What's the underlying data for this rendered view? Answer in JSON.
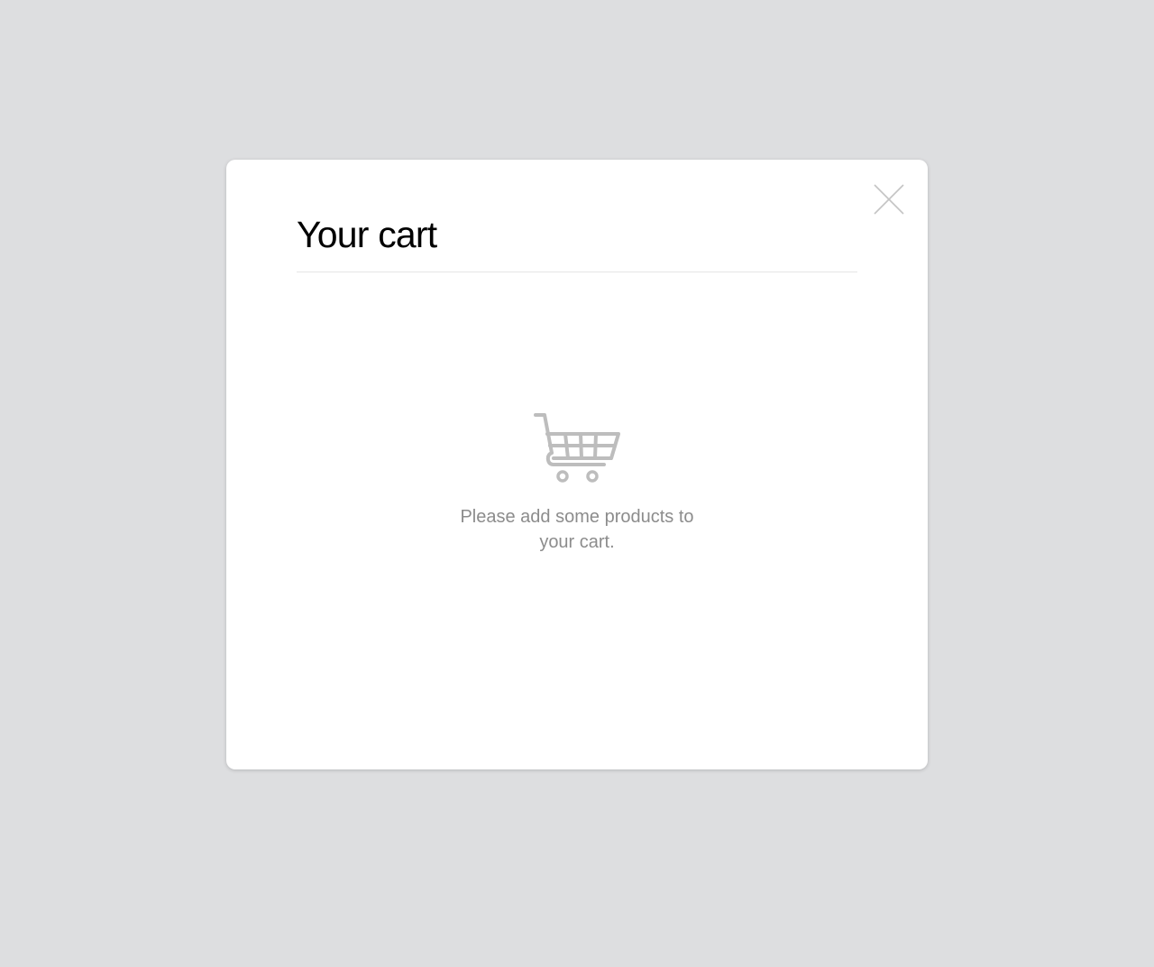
{
  "modal": {
    "title": "Your cart",
    "close_icon": "close-icon",
    "empty_state": {
      "icon": "shopping-cart-icon",
      "message": "Please add some products to your cart."
    }
  },
  "colors": {
    "backdrop": "#dddee0",
    "panel": "#ffffff",
    "title_text": "#000000",
    "muted_text": "#8c8c8c",
    "icon_gray": "#bdbdbd"
  }
}
